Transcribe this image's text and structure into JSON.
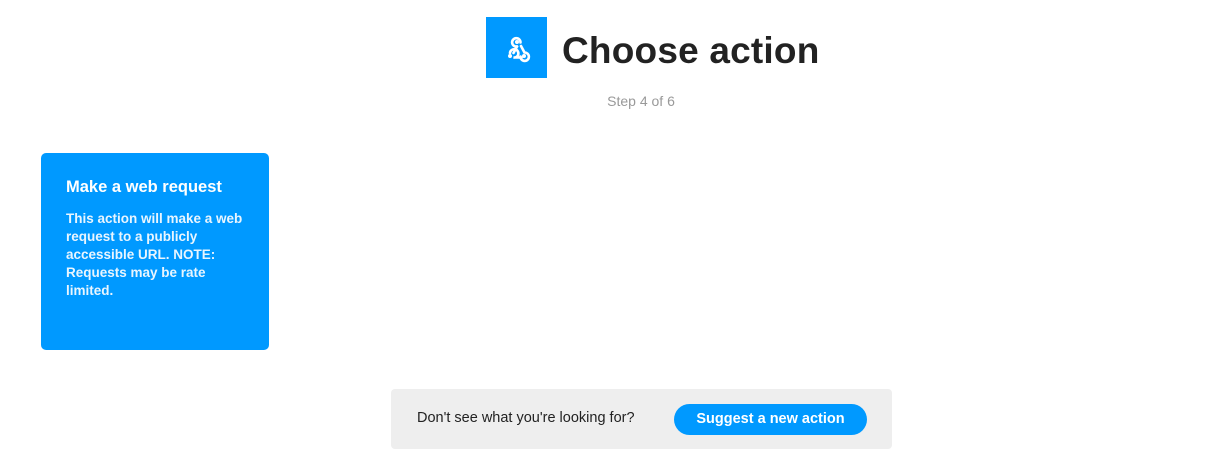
{
  "header": {
    "logo_icon": "webhook-icon",
    "logo_color": "#0099ff",
    "title": "Choose action",
    "step": "Step 4 of 6"
  },
  "actions": [
    {
      "title": "Make a web request",
      "description": "This action will make a web request to a publicly accessible URL. NOTE: Requests may be rate limited.",
      "color": "#0099ff"
    }
  ],
  "suggest": {
    "prompt": "Don't see what you're looking for?",
    "button_label": "Suggest a new action"
  }
}
